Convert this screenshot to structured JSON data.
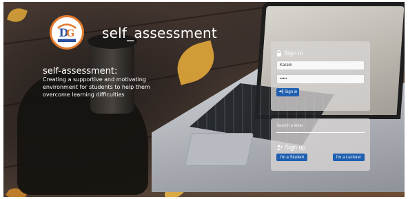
{
  "brand": {
    "name": "self_assessment",
    "logo_icon": "institution-logo-icon"
  },
  "intro": {
    "title": "self-assessment:",
    "text": "Creating a supportive and motivating environment for students to help them overcome learning difficulties"
  },
  "signin": {
    "title": "Sign in",
    "title_icon": "lock-icon",
    "username_value": "Karam",
    "password_value": "•••••",
    "button_label": "Sign in",
    "button_icon": "sign-in-icon"
  },
  "signup": {
    "search_text": "Search a letter",
    "title": "Sign up",
    "title_icon": "user-plus-icon",
    "student_button": "I'm a Student",
    "lecturer_button": "I'm a Lecturer"
  },
  "colors": {
    "button": "#1f5fb0",
    "logo_ring": "#e07a2e",
    "card": "#d7d4d2"
  }
}
